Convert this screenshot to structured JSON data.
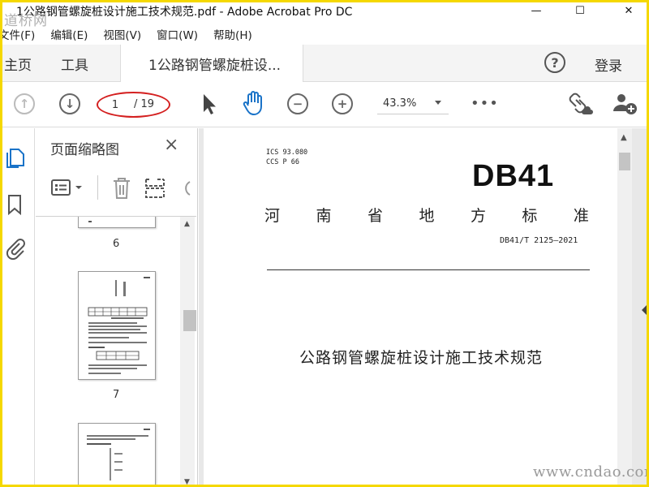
{
  "window": {
    "title": "1公路钢管螺旋桩设计施工技术规范.pdf - Adobe Acrobat Pro DC",
    "watermark_top": "道桥网",
    "watermark_bottom": "www.cndao.com"
  },
  "menu": {
    "items": [
      "文件(F)",
      "编辑(E)",
      "视图(V)",
      "窗口(W)",
      "帮助(H)"
    ]
  },
  "tabs": {
    "home": "主页",
    "tools": "工具",
    "document": "1公路钢管螺旋桩设...",
    "close": "×",
    "help": "?",
    "login": "登录"
  },
  "toolbar": {
    "page_current": "1",
    "page_total": "/ 19",
    "zoom": "43.3%",
    "more": "•••"
  },
  "thumbnail_panel": {
    "title": "页面缩略图",
    "close": "×",
    "pages": [
      {
        "label": "6"
      },
      {
        "label": "7"
      },
      {
        "label": ""
      }
    ]
  },
  "document": {
    "ics": "ICS  93.080",
    "ccs": "CCS  P  66",
    "standard": "DB41",
    "province_chars": [
      "河",
      "南",
      "省",
      "地",
      "方",
      "标",
      "准"
    ],
    "code": "DB41/T 2125—2021",
    "title": "公路钢管螺旋桩设计施工技术规范"
  },
  "colors": {
    "frame": "#f5d800",
    "annotation": "#d42020",
    "hand_tool": "#1a73c8",
    "rail_active": "#1a73c8"
  }
}
